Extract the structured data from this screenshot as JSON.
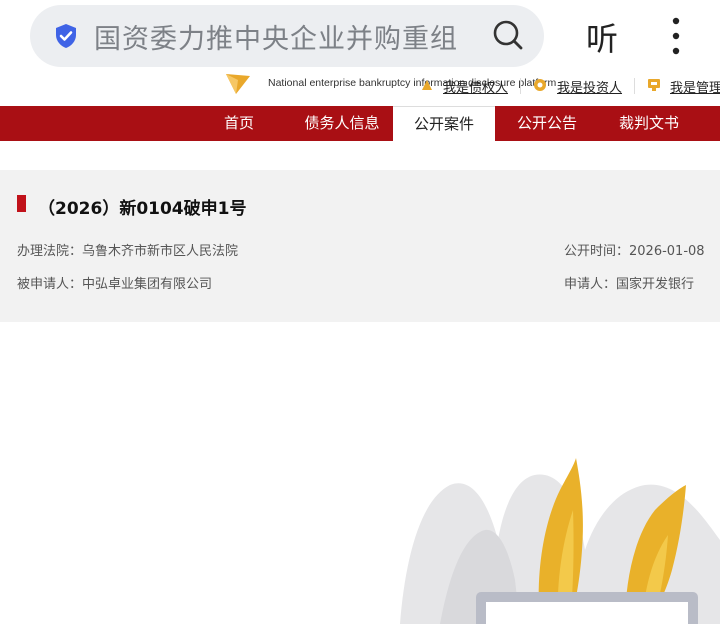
{
  "browser": {
    "search_text": "国资委力推中央企业并购重组",
    "listen_label": "听",
    "icons": {
      "shield": "shield-check-icon",
      "search": "search-icon",
      "more": "more-vertical-icon"
    }
  },
  "site": {
    "english_name": "National enterprise bankruptcy information disclosure platform",
    "quick_links": [
      "我是债权人",
      "我是投资人",
      "我是管理"
    ],
    "colors": {
      "primary_red": "#a90f14",
      "accent_gold": "#e9a82b"
    }
  },
  "nav": {
    "items": [
      "首页",
      "债务人信息",
      "公开案件",
      "公开公告",
      "裁判文书"
    ],
    "active_index": 2
  },
  "case": {
    "title": "（2026）新0104破申1号",
    "court_label": "办理法院：",
    "court": "乌鲁木齐市新市区人民法院",
    "date_label": "公开时间：",
    "date": "2026-01-08",
    "respondent_label": "被申请人：",
    "respondent": "中弘卓业集团有限公司",
    "applicant_label": "申请人：",
    "applicant": "国家开发银行"
  }
}
